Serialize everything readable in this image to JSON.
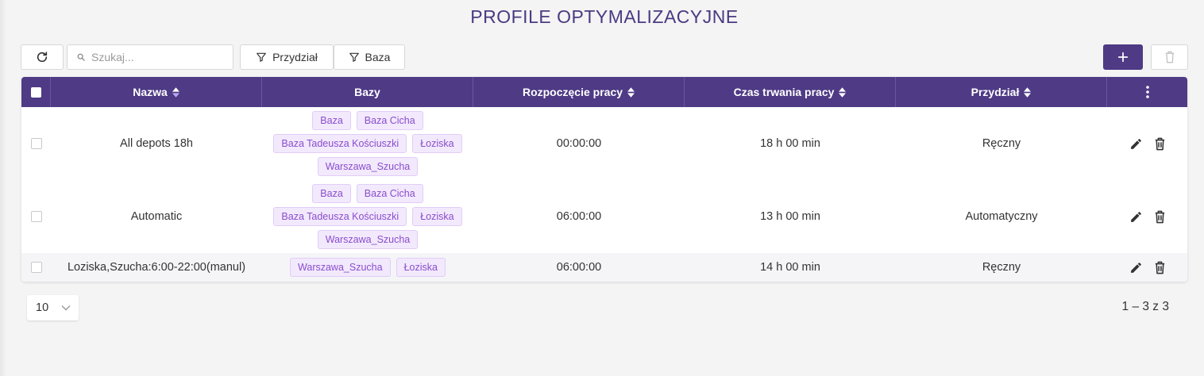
{
  "page": {
    "title": "PROFILE OPTYMALIZACYJNE"
  },
  "toolbar": {
    "search_placeholder": "Szukaj...",
    "filters": [
      {
        "label": "Przydział",
        "icon": "filter-icon"
      },
      {
        "label": "Baza",
        "icon": "filter-icon"
      }
    ],
    "refresh_icon": "refresh-icon",
    "add_icon": "plus-icon",
    "delete_icon": "trash-icon"
  },
  "table": {
    "columns": [
      {
        "label": "",
        "type": "checkbox"
      },
      {
        "label": "Nazwa",
        "sortable": true,
        "sort": "active"
      },
      {
        "label": "Bazy",
        "sortable": false
      },
      {
        "label": "Rozpoczęcie pracy",
        "sortable": true
      },
      {
        "label": "Czas trwania pracy",
        "sortable": true
      },
      {
        "label": "Przydział",
        "sortable": true
      },
      {
        "label": "",
        "type": "menu",
        "icon": "more-vertical-icon"
      }
    ],
    "rows": [
      {
        "name": "All depots 18h",
        "bases": [
          "Baza",
          "Baza Cicha",
          "Baza Tadeusza Kościuszki",
          "Łoziska",
          "Warszawa_Szucha"
        ],
        "start": "00:00:00",
        "duration": "18 h 00 min",
        "assignment": "Ręczny"
      },
      {
        "name": "Automatic",
        "bases": [
          "Baza",
          "Baza Cicha",
          "Baza Tadeusza Kościuszki",
          "Łoziska",
          "Warszawa_Szucha"
        ],
        "start": "06:00:00",
        "duration": "13 h 00 min",
        "assignment": "Automatyczny"
      },
      {
        "name": "Loziska,Szucha:6:00-22:00(manul)",
        "bases": [
          "Warszawa_Szucha",
          "Łoziska"
        ],
        "start": "06:00:00",
        "duration": "14 h 00 min",
        "assignment": "Ręczny"
      }
    ]
  },
  "pagination": {
    "page_size": "10",
    "range": "1 – 3 z 3"
  },
  "colors": {
    "accent": "#4e3a85",
    "title": "#4b3a82",
    "chip_bg": "#f2e9fd",
    "chip_text": "#8a4dcc"
  }
}
